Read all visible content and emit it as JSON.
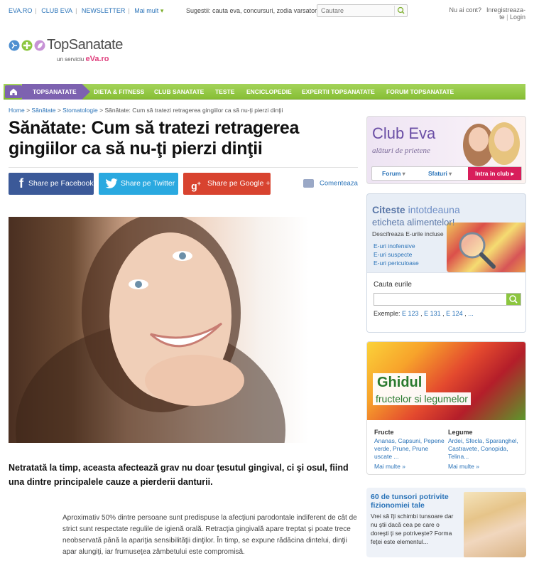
{
  "topbar": {
    "links": [
      "EVA.RO",
      "CLUB EVA",
      "NEWSLETTER",
      "Mai mult"
    ],
    "suggestions": "Sugestii: cauta eva, concursuri, zodia varsator",
    "search_placeholder": "Cautare",
    "login_question": "Nu ai cont?",
    "register": "Inregistreaza-te",
    "login": "Login"
  },
  "logo": {
    "name": "TopSanatate",
    "sub_prefix": "un serviciu",
    "sub_brand": "eVa.ro"
  },
  "nav": {
    "active": "TOPSANATATE",
    "items": [
      "DIETA & FITNESS",
      "CLUB SANATATE",
      "TESTE",
      "ENCICLOPEDIE",
      "EXPERTII TOPSANATATE",
      "FORUM TOPSANATATE"
    ]
  },
  "breadcrumb": {
    "items": [
      "Home",
      "Sănătate",
      "Stomatologie"
    ],
    "separator": ">",
    "current": "Sănătate: Cum să tratezi retragerea gingiilor ca să nu-ţi pierzi dinţii"
  },
  "article": {
    "title": "Sănătate: Cum să tratezi retragerea gingiilor ca să nu-ţi pierzi dinţii",
    "share_facebook": "Share pe Facebook",
    "share_twitter": "Share pe Twitter",
    "share_google": "Share pe Google +",
    "comment": "Comenteaza",
    "lead": "Netratată la timp, aceasta afectează grav nu doar ţesutul gingival, ci şi osul, fiind una dintre principalele cauze a pierderii danturii.",
    "body": "Aproximativ 50% dintre persoane sunt predispuse la afecţiuni parodontale indiferent de cât de strict sunt respectate regulile de igienă orală. Retracţia gingivală apare treptat şi poate trece neobservată până la apariţia sensibilităţii dinţilor. În timp, se expune rădăcina dintelui, dinţii apar alungiţi, iar frumuseţea zâmbetului este compromisă."
  },
  "sidebar": {
    "club_eva": {
      "title": "Club Eva",
      "tagline": "alături de prietene",
      "tab_forum": "Forum",
      "tab_sfaturi": "Sfaturi",
      "cta": "Intra in club"
    },
    "citeste": {
      "headline_bold": "Citeste",
      "headline_rest": "intotdeauna",
      "line2": "eticheta alimentelor!",
      "sub": "Descifreaza E-urile incluse",
      "links": [
        "E-uri inofensive",
        "E-uri suspecte",
        "E-uri periculoase"
      ],
      "search_label": "Cauta eurile",
      "examples_label": "Exemple:",
      "examples": [
        "E 123",
        "E 131",
        "E 124",
        "..."
      ]
    },
    "ghidul": {
      "title": "Ghidul",
      "subtitle": "fructelor si legumelor",
      "fructe_title": "Fructe",
      "fructe_text": "Ananas, Capsuni, Pepene verde, Prune, Prune uscate ...",
      "legume_title": "Legume",
      "legume_text": "Ardei, Sfecla, Sparanghel, Castravete, Conopida, Telina...",
      "more": "Mai multe »"
    },
    "tunsori": {
      "headline": "60 de tunsori potrivite fizionomiei tale",
      "text": "Vrei să îţi schimbi tunsoare dar nu ştii dacă cea pe care o doreşti ţi se potriveşte? Forma feţei este elementul..."
    }
  },
  "colors": {
    "nav_green": "#87be35",
    "nav_purple": "#7d62b0",
    "link_blue": "#2a73b8",
    "facebook": "#3b5998",
    "twitter": "#2aa9e0",
    "google": "#d8432f",
    "club_cta": "#d81e5b"
  }
}
